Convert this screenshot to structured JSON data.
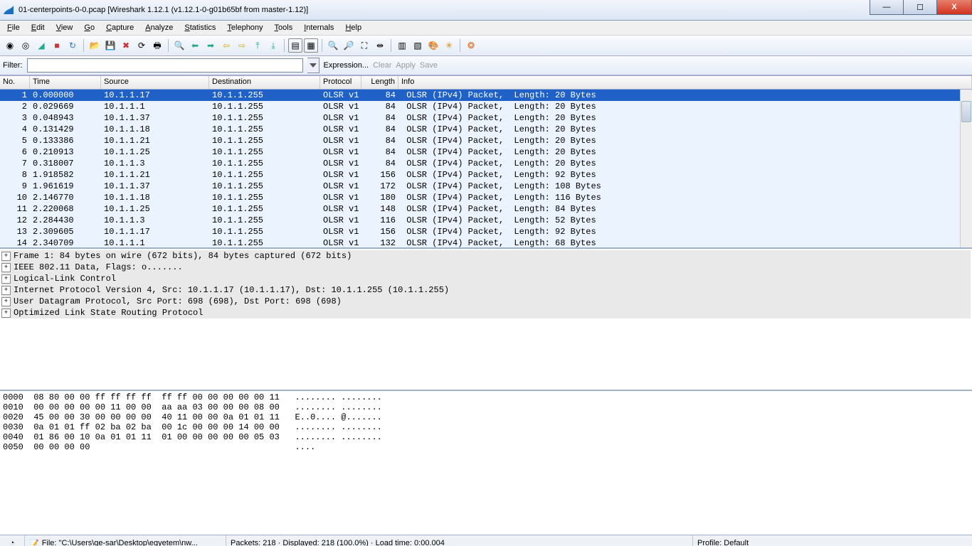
{
  "title": "01-centerpoints-0-0.pcap   [Wireshark 1.12.1  (v1.12.1-0-g01b65bf from master-1.12)]",
  "menus": [
    "File",
    "Edit",
    "View",
    "Go",
    "Capture",
    "Analyze",
    "Statistics",
    "Telephony",
    "Tools",
    "Internals",
    "Help"
  ],
  "filter": {
    "label": "Filter:",
    "value": "",
    "expression": "Expression...",
    "clear": "Clear",
    "apply": "Apply",
    "save": "Save"
  },
  "columns": {
    "no": "No.",
    "time": "Time",
    "src": "Source",
    "dst": "Destination",
    "proto": "Protocol",
    "len": "Length",
    "info": "Info"
  },
  "packets": [
    {
      "no": "1",
      "time": "0.000000",
      "src": "10.1.1.17",
      "dst": "10.1.1.255",
      "proto": "OLSR v1",
      "len": "84",
      "info": "OLSR (IPv4) Packet,  Length: 20 Bytes",
      "sel": true
    },
    {
      "no": "2",
      "time": "0.029669",
      "src": "10.1.1.1",
      "dst": "10.1.1.255",
      "proto": "OLSR v1",
      "len": "84",
      "info": "OLSR (IPv4) Packet,  Length: 20 Bytes"
    },
    {
      "no": "3",
      "time": "0.048943",
      "src": "10.1.1.37",
      "dst": "10.1.1.255",
      "proto": "OLSR v1",
      "len": "84",
      "info": "OLSR (IPv4) Packet,  Length: 20 Bytes"
    },
    {
      "no": "4",
      "time": "0.131429",
      "src": "10.1.1.18",
      "dst": "10.1.1.255",
      "proto": "OLSR v1",
      "len": "84",
      "info": "OLSR (IPv4) Packet,  Length: 20 Bytes"
    },
    {
      "no": "5",
      "time": "0.133386",
      "src": "10.1.1.21",
      "dst": "10.1.1.255",
      "proto": "OLSR v1",
      "len": "84",
      "info": "OLSR (IPv4) Packet,  Length: 20 Bytes"
    },
    {
      "no": "6",
      "time": "0.210913",
      "src": "10.1.1.25",
      "dst": "10.1.1.255",
      "proto": "OLSR v1",
      "len": "84",
      "info": "OLSR (IPv4) Packet,  Length: 20 Bytes"
    },
    {
      "no": "7",
      "time": "0.318007",
      "src": "10.1.1.3",
      "dst": "10.1.1.255",
      "proto": "OLSR v1",
      "len": "84",
      "info": "OLSR (IPv4) Packet,  Length: 20 Bytes"
    },
    {
      "no": "8",
      "time": "1.918582",
      "src": "10.1.1.21",
      "dst": "10.1.1.255",
      "proto": "OLSR v1",
      "len": "156",
      "info": "OLSR (IPv4) Packet,  Length: 92 Bytes"
    },
    {
      "no": "9",
      "time": "1.961619",
      "src": "10.1.1.37",
      "dst": "10.1.1.255",
      "proto": "OLSR v1",
      "len": "172",
      "info": "OLSR (IPv4) Packet,  Length: 108 Bytes"
    },
    {
      "no": "10",
      "time": "2.146770",
      "src": "10.1.1.18",
      "dst": "10.1.1.255",
      "proto": "OLSR v1",
      "len": "180",
      "info": "OLSR (IPv4) Packet,  Length: 116 Bytes"
    },
    {
      "no": "11",
      "time": "2.220068",
      "src": "10.1.1.25",
      "dst": "10.1.1.255",
      "proto": "OLSR v1",
      "len": "148",
      "info": "OLSR (IPv4) Packet,  Length: 84 Bytes"
    },
    {
      "no": "12",
      "time": "2.284430",
      "src": "10.1.1.3",
      "dst": "10.1.1.255",
      "proto": "OLSR v1",
      "len": "116",
      "info": "OLSR (IPv4) Packet,  Length: 52 Bytes"
    },
    {
      "no": "13",
      "time": "2.309605",
      "src": "10.1.1.17",
      "dst": "10.1.1.255",
      "proto": "OLSR v1",
      "len": "156",
      "info": "OLSR (IPv4) Packet,  Length: 92 Bytes"
    },
    {
      "no": "14",
      "time": "2.340709",
      "src": "10.1.1.1",
      "dst": "10.1.1.255",
      "proto": "OLSR v1",
      "len": "132",
      "info": "OLSR (IPv4) Packet,  Length: 68 Bytes"
    }
  ],
  "details": [
    "Frame 1: 84 bytes on wire (672 bits), 84 bytes captured (672 bits)",
    "IEEE 802.11 Data, Flags: o.......",
    "Logical-Link Control",
    "Internet Protocol Version 4, Src: 10.1.1.17 (10.1.1.17), Dst: 10.1.1.255 (10.1.1.255)",
    "User Datagram Protocol, Src Port: 698 (698), Dst Port: 698 (698)",
    "Optimized Link State Routing Protocol"
  ],
  "hex": [
    "0000  08 80 00 00 ff ff ff ff  ff ff 00 00 00 00 00 11   ........ ........",
    "0010  00 00 00 00 00 11 00 00  aa aa 03 00 00 00 08 00   ........ ........",
    "0020  45 00 00 30 00 00 00 00  40 11 00 00 0a 01 01 11   E..0.... @.......",
    "0030  0a 01 01 ff 02 ba 02 ba  00 1c 00 00 00 14 00 00   ........ ........",
    "0040  01 86 00 10 0a 01 01 11  01 00 00 00 00 00 05 03   ........ ........",
    "0050  00 00 00 00                                        ...."
  ],
  "status": {
    "file": "File: \"C:\\Users\\ge-sar\\Desktop\\egyetem\\nw...",
    "center": "Packets: 218 · Displayed: 218 (100.0%) · Load time: 0:00.004",
    "profile": "Profile: Default"
  },
  "winbtns": {
    "min": "—",
    "max": "☐",
    "close": "X"
  }
}
